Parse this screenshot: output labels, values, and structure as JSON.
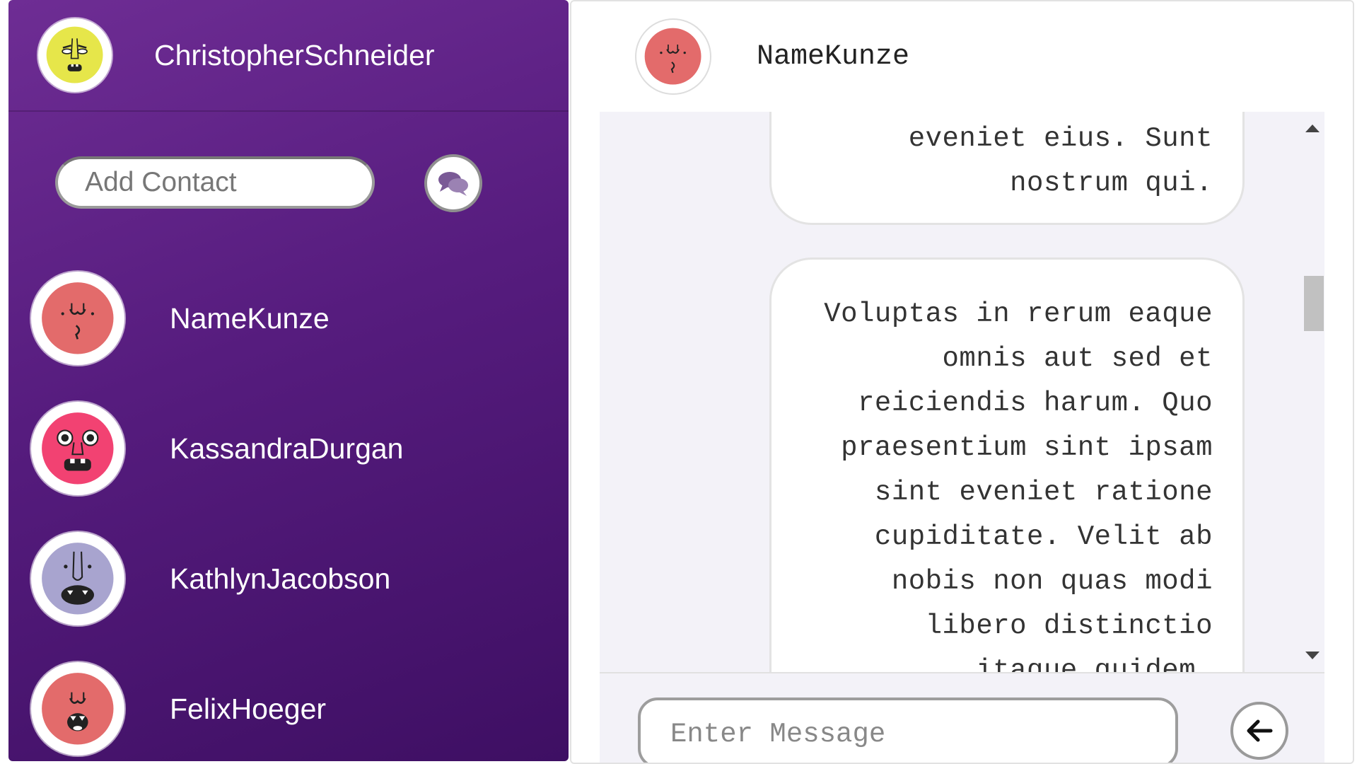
{
  "sidebar": {
    "current_user": {
      "name": "ChristopherSchneider",
      "avatar_color": "#e6e64a"
    },
    "add_contact": {
      "placeholder": "Add Contact"
    },
    "contacts": [
      {
        "name": "NameKunze",
        "avatar_color": "#e36b6b"
      },
      {
        "name": "KassandraDurgan",
        "avatar_color": "#f24272"
      },
      {
        "name": "KathlynJacobson",
        "avatar_color": "#a8a4cf"
      },
      {
        "name": "FelixHoeger",
        "avatar_color": "#e36b6b"
      }
    ]
  },
  "chat": {
    "title": "NameKunze",
    "avatar_color": "#e36b6b",
    "messages": [
      {
        "lines": [
          "eveniet eius. Sunt",
          "nostrum qui."
        ]
      },
      {
        "lines": [
          "Voluptas in rerum eaque",
          "omnis aut sed et",
          "reiciendis harum. Quo",
          "praesentium sint ipsam",
          "sint eveniet ratione",
          "cupiditate. Velit ab",
          "nobis non quas modi",
          "libero distinctio",
          "itaque quidem."
        ]
      }
    ],
    "composer": {
      "placeholder": "Enter Message"
    }
  },
  "colors": {
    "sidebar_top": "#6e2d94",
    "sidebar_bottom": "#3e0f63",
    "chat_bg": "#f3f2f8"
  },
  "icons": {
    "add_chat": "chat-bubbles-icon",
    "send": "arrow-left-icon"
  }
}
